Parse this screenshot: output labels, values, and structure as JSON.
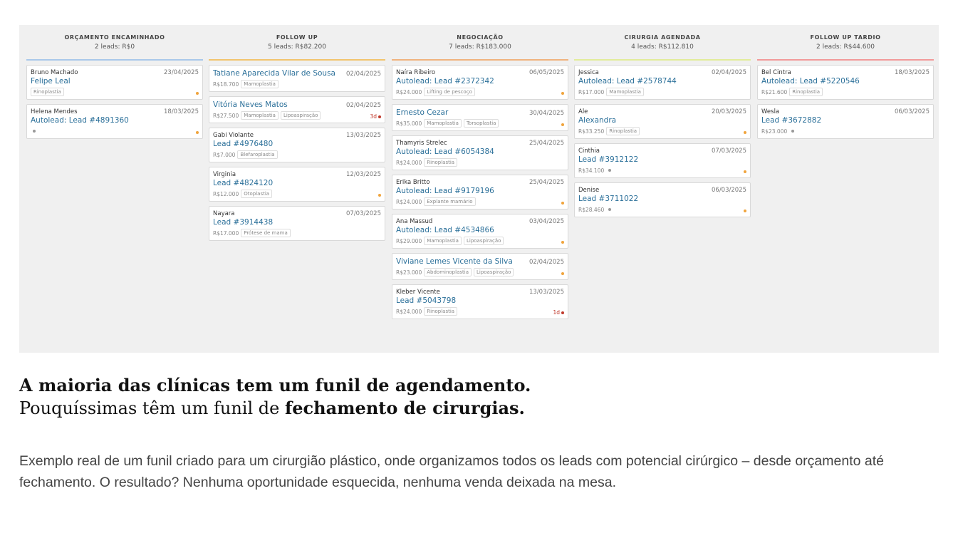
{
  "colors": {
    "accent_blue": "#a9c8ea",
    "accent_yellow": "#f2c46d",
    "accent_orange": "#f0b37e",
    "accent_green": "#e2ec9a",
    "accent_red": "#f29a9a",
    "link": "#2a6f99",
    "dot_orange": "#f0a43c",
    "dot_gray": "#999999",
    "dot_red": "#c0392b"
  },
  "columns": [
    {
      "title": "ORÇAMENTO ENCAMINHADO",
      "subtitle": "2 leads: R$0",
      "cards": [
        {
          "contact": "Bruno Machado",
          "date": "23/04/2025",
          "title": "Felipe Leal",
          "value": "",
          "tags": [
            "Rinoplastia"
          ],
          "marker": "dot-orange"
        },
        {
          "contact": "Helena Mendes",
          "date": "18/03/2025",
          "title": "Autolead: Lead #4891360",
          "value": "",
          "tags": [],
          "marker": "dot-orange",
          "gray_dot": true
        }
      ]
    },
    {
      "title": "FOLLOW UP",
      "subtitle": "5 leads: R$82.200",
      "cards": [
        {
          "contact": "",
          "date": "02/04/2025",
          "title": "Tatiane Aparecida Vilar de Sousa",
          "value": "R$18.700",
          "tags": [
            "Mamoplastia"
          ],
          "marker": ""
        },
        {
          "contact": "",
          "date": "02/04/2025",
          "title": "Vitória Neves Matos",
          "value": "R$27.500",
          "tags": [
            "Mamoplastia",
            "Lipoaspiração"
          ],
          "marker": "badge",
          "badge": "3d"
        },
        {
          "contact": "Gabi Violante",
          "date": "13/03/2025",
          "title": "Lead #4976480",
          "value": "R$7.000",
          "tags": [
            "Blefaroplastia"
          ],
          "marker": ""
        },
        {
          "contact": "Virginia",
          "date": "12/03/2025",
          "title": "Lead #4824120",
          "value": "R$12.000",
          "tags": [
            "Otoplastia"
          ],
          "marker": "dot-orange"
        },
        {
          "contact": "Nayara",
          "date": "07/03/2025",
          "title": "Lead #3914438",
          "value": "R$17.000",
          "tags": [
            "Prótese de mama"
          ],
          "marker": ""
        }
      ]
    },
    {
      "title": "NEGOCIAÇÃO",
      "subtitle": "7 leads: R$183.000",
      "cards": [
        {
          "contact": "Naíra Ribeiro",
          "date": "06/05/2025",
          "title": "Autolead: Lead #2372342",
          "value": "R$24.000",
          "tags": [
            "Lifting de pescoço"
          ],
          "marker": "dot-orange"
        },
        {
          "contact": "",
          "date": "30/04/2025",
          "title": "Ernesto Cezar",
          "value": "R$35.000",
          "tags": [
            "Mamoplastia",
            "Torsoplastia"
          ],
          "marker": "dot-orange"
        },
        {
          "contact": "Thamyris Strelec",
          "date": "25/04/2025",
          "title": "Autolead: Lead #6054384",
          "value": "R$24.000",
          "tags": [
            "Rinoplastia"
          ],
          "marker": ""
        },
        {
          "contact": "Erika Britto",
          "date": "25/04/2025",
          "title": "Autolead: Lead #9179196",
          "value": "R$24.000",
          "tags": [
            "Explante mamário"
          ],
          "marker": "dot-orange"
        },
        {
          "contact": "Ana Massud",
          "date": "03/04/2025",
          "title": "Autolead: Lead #4534866",
          "value": "R$29.000",
          "tags": [
            "Mamoplastia",
            "Lipoaspiração"
          ],
          "marker": "dot-orange"
        },
        {
          "contact": "",
          "date": "02/04/2025",
          "title": "Viviane Lemes Vicente da Silva",
          "value": "R$23.000",
          "tags": [
            "Abdominoplastia",
            "Lipoaspiração"
          ],
          "marker": "dot-orange"
        },
        {
          "contact": "Kleber Vicente",
          "date": "13/03/2025",
          "title": "Lead #5043798",
          "value": "R$24.000",
          "tags": [
            "Rinoplastia"
          ],
          "marker": "badge",
          "badge": "1d"
        }
      ]
    },
    {
      "title": "CIRURGIA AGENDADA",
      "subtitle": "4 leads: R$112.810",
      "cards": [
        {
          "contact": "Jessica",
          "date": "02/04/2025",
          "title": "Autolead: Lead #2578744",
          "value": "R$17.000",
          "tags": [
            "Mamoplastia"
          ],
          "marker": ""
        },
        {
          "contact": "Ale",
          "date": "20/03/2025",
          "title": "Alexandra",
          "value": "R$33.250",
          "tags": [
            "Rinoplastia"
          ],
          "marker": "dot-orange"
        },
        {
          "contact": "Cinthia",
          "date": "07/03/2025",
          "title": "Lead #3912122",
          "value": "R$34.100",
          "tags": [],
          "marker": "dot-orange",
          "gray_dot": true
        },
        {
          "contact": "Denise",
          "date": "06/03/2025",
          "title": "Lead #3711022",
          "value": "R$28.460",
          "tags": [],
          "marker": "dot-orange",
          "gray_dot": true
        }
      ]
    },
    {
      "title": "FOLLOW UP TARDIO",
      "subtitle": "2 leads: R$44.600",
      "cards": [
        {
          "contact": "Bel Cintra",
          "date": "18/03/2025",
          "title": "Autolead: Lead #5220546",
          "value": "R$21.600",
          "tags": [
            "Rinoplastia"
          ],
          "marker": ""
        },
        {
          "contact": "Wesla",
          "date": "06/03/2025",
          "title": "Lead #3672882",
          "value": "R$23.000",
          "tags": [],
          "marker": "",
          "gray_dot": true
        }
      ]
    }
  ],
  "headline": {
    "line1": "A maioria das clínicas tem um funil de agendamento.",
    "line2_plain": "Pouquíssimas têm um funil de ",
    "line2_bold": "fechamento de cirurgias."
  },
  "paragraph": "Exemplo real de um funil criado para um cirurgião plástico, onde organizamos todos os leads com potencial cirúrgico – desde orçamento até fechamento. O resultado? Nenhuma oportunidade esquecida, nenhuma venda deixada na mesa."
}
